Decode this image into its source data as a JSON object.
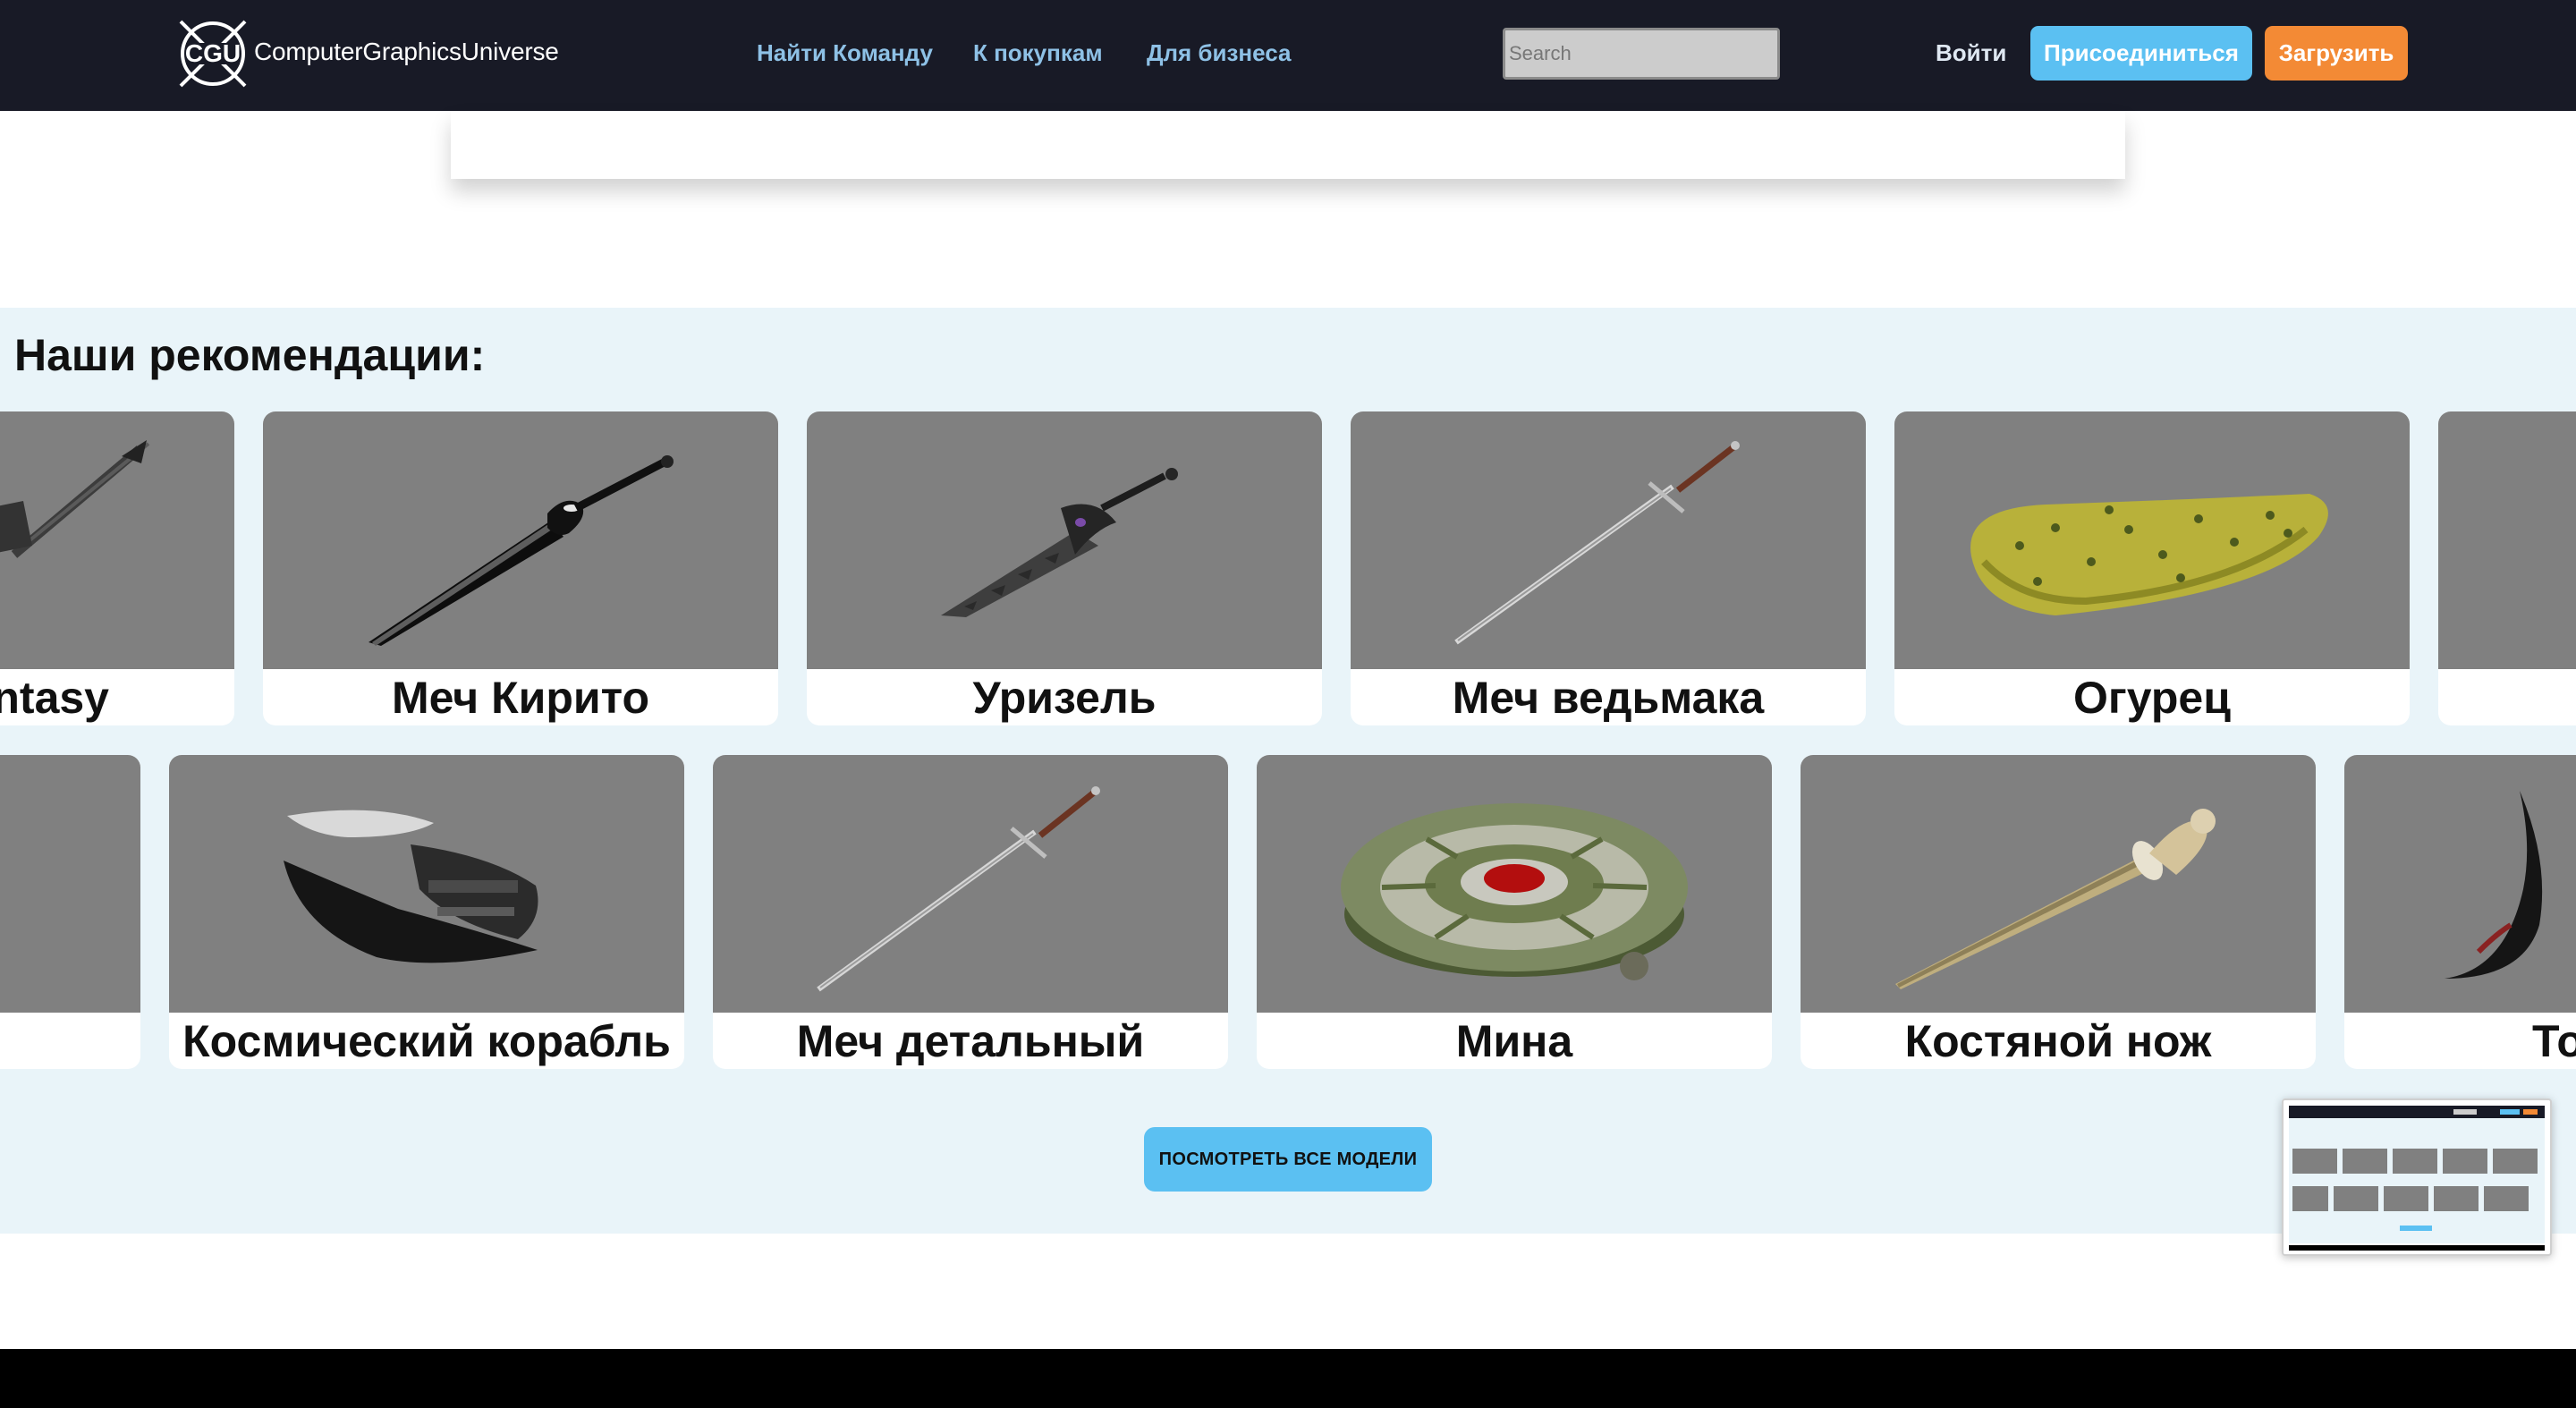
{
  "header": {
    "brand": "ComputerGraphicsUniverse",
    "logo_text": "CGU",
    "nav": [
      "Найти Команду",
      "К покупкам",
      "Для бизнеса"
    ],
    "search_placeholder": "Search",
    "login": "Войти",
    "join": "Присоединиться",
    "upload": "Загрузить"
  },
  "recommendations": {
    "title": "Наши рекомендации:",
    "row1": [
      "ntasy",
      "Меч Кирито",
      "Уризель",
      "Меч ведьмака",
      "Огурец",
      ""
    ],
    "row2": [
      "",
      "Космический корабль",
      "Меч детальный",
      "Мина",
      "Костяной нож",
      "То"
    ],
    "view_all": "ПОСМОТРЕТЬ ВСЕ МОДЕЛИ"
  },
  "colors": {
    "header_bg": "#181a26",
    "nav_link": "#8ec1e6",
    "join_button": "#5bc0f2",
    "upload_button": "#f38a35",
    "section_bg": "#e9f4f9",
    "thumb_bg": "#808080"
  }
}
